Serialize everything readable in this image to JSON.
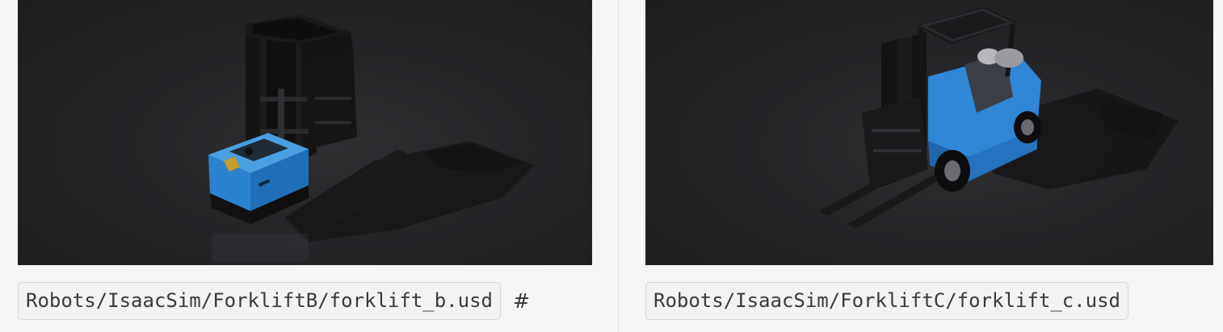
{
  "colors": {
    "page_background": "#f6f6f6",
    "render_background": "#252528",
    "forklift_blue": "#2f87d6",
    "code_background": "#f3f3f3",
    "code_border": "#d6d6d6"
  },
  "gallery": [
    {
      "image_label": "ForkliftB render",
      "path": "Robots/IsaacSim/ForkliftB/forklift_b.usd",
      "anchor": "#"
    },
    {
      "image_label": "ForkliftC render",
      "path": "Robots/IsaacSim/ForkliftC/forklift_c.usd"
    }
  ]
}
